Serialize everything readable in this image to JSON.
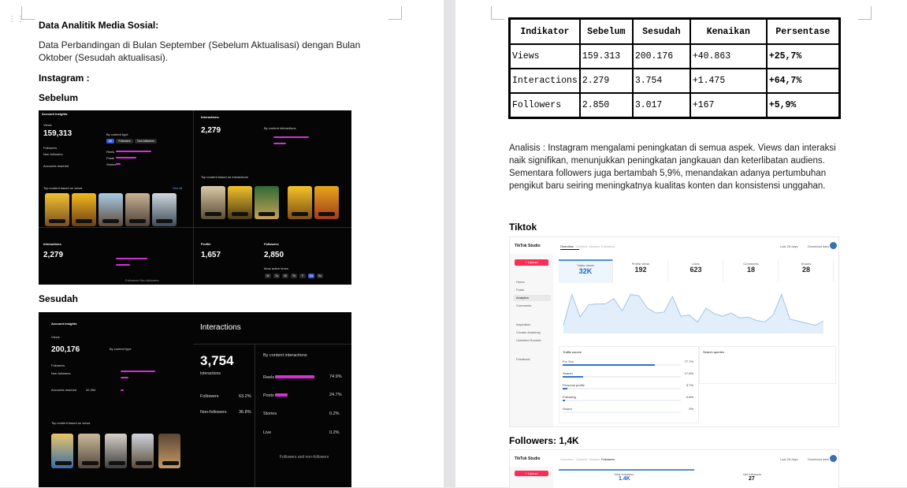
{
  "doc": {
    "title": "Data Analitik Media Sosial:",
    "intro": "Data Perbandingan di Bulan September (Sebelum Aktualisasi) dengan Bulan Oktober (Sesudah aktualisasi).",
    "instagram_heading": "Instagram :",
    "sebelum_label": "Sebelum",
    "sesudah_label": "Sesudah",
    "analysis": "Analisis : Instagram mengalami peningkatan di semua aspek. Views dan interaksi naik signifikan, menunjukkan peningkatan jangkauan dan keterlibatan audiens. Sementara followers juga bertambah 5,9%, menandakan adanya pertumbuhan pengikut baru seiring meningkatnya kualitas konten dan konsistensi unggahan.",
    "tiktok_heading": "Tiktok",
    "followers_heading": "Followers: 1,4K"
  },
  "table": {
    "headers": [
      "Indikator",
      "Sebelum",
      "Sesudah",
      "Kenaikan",
      "Persentase"
    ],
    "rows": [
      [
        "Views",
        "159.313",
        "200.176",
        "+40.863",
        "+25,7%"
      ],
      [
        "Interactions",
        "2.279",
        "3.754",
        "+1.475",
        "+64,7%"
      ],
      [
        "Followers",
        "2.850",
        "3.017",
        "+167",
        "+5,9%"
      ]
    ]
  },
  "ig_before": {
    "account_insights": "Account insights",
    "views_label": "Views",
    "views": "159,313",
    "by_content_type": "By content type",
    "followers_label": "Followers",
    "non_followers_label": "Non-followers",
    "accounts_reached": "Accounts reached",
    "tab_all": "All",
    "tab_followers": "Followers",
    "tab_non_followers": "Non-followers",
    "reels": "Reels",
    "posts": "Posts",
    "stories": "Stories",
    "interactions_label": "Interactions",
    "interactions": "2,279",
    "by_content_interactions": "By content interactions",
    "top_content_views": "Top content based on views",
    "top_content_interactions": "Top content based on interactions",
    "see_all": "See all",
    "profile_label": "Profile",
    "profile_visits": "1,657",
    "followers_total": "2,850",
    "most_active_times": "Most active times",
    "days": [
      "M",
      "Tu",
      "W",
      "Th",
      "F",
      "Sa",
      "Su"
    ],
    "legend": "Followers  Non-followers"
  },
  "ig_after": {
    "account_insights": "Account insights",
    "views_label": "Views",
    "views": "200,176",
    "by_content_type": "By content type",
    "followers_label": "Followers",
    "non_followers_label": "Non-followers",
    "accounts_reached": "Accounts reached",
    "reached": "32,354",
    "top_content_views": "Top content based on views",
    "interactions_label": "Interactions",
    "interactions": "3,754",
    "interactions_sub": "Interactions",
    "followers_pct": "63.2%",
    "non_followers_pct": "36.8%",
    "by_content_interactions": "By content interactions",
    "reels": "Reels",
    "posts": "Posts",
    "stories": "Stories",
    "live": "Live",
    "reels_pct": "74.9%",
    "posts_pct": "24.7%",
    "stories_pct": "0.2%",
    "live_pct": "0.2%",
    "legend": "Followers and non-followers"
  },
  "tiktok": {
    "brand": "TikTok Studio",
    "nav_tabs": [
      "Overview",
      "Content",
      "Viewers",
      "Followers"
    ],
    "upload": "+ Upload",
    "sidebar": [
      "Home",
      "Posts",
      "Analytics",
      "Comments",
      "Inspiration",
      "Creator Academy",
      "Unlimited Sounds",
      "Feedback"
    ],
    "range": "Last 28 days",
    "download": "Download data",
    "metrics": [
      {
        "label": "Video views",
        "value": "32K"
      },
      {
        "label": "Profile views",
        "value": "192"
      },
      {
        "label": "Likes",
        "value": "623"
      },
      {
        "label": "Comments",
        "value": "18"
      },
      {
        "label": "Shares",
        "value": "28"
      }
    ],
    "traffic_title": "Traffic source",
    "traffic": [
      {
        "label": "For You",
        "value": "77.7%",
        "frac": 0.777
      },
      {
        "label": "Search",
        "value": "17.6%",
        "frac": 0.176
      },
      {
        "label": "Personal profile",
        "value": "3.7%",
        "frac": 0.037
      },
      {
        "label": "Following",
        "value": "0.8%",
        "frac": 0.008
      },
      {
        "label": "Sound",
        "value": "0%",
        "frac": 0
      }
    ],
    "search_title": "Search queries",
    "followers_total_label": "Total followers",
    "followers_total": "1.4K",
    "net_followers_label": "Net followers",
    "net_followers": "27"
  },
  "colors": {
    "accent_pink": "#d62fd8",
    "tiktok_red": "#fe2c55",
    "chart_blue": "#9ec5ea"
  }
}
